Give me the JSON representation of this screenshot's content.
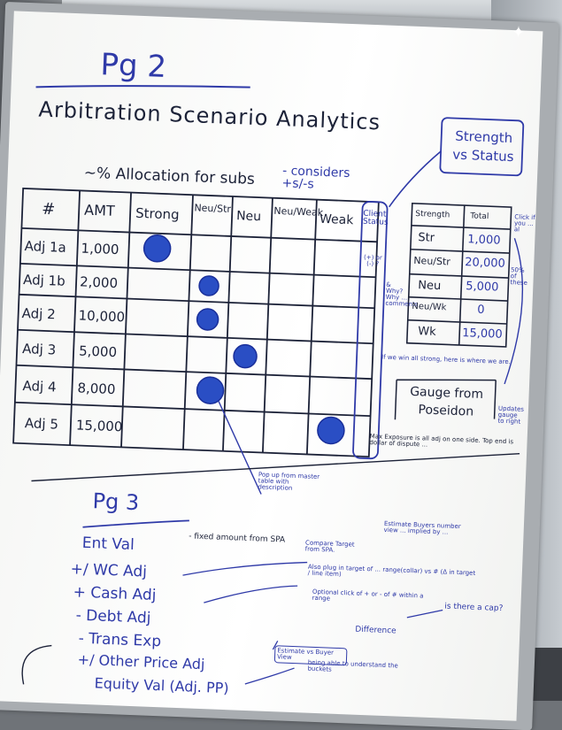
{
  "whiteboard": {
    "page2": {
      "heading": "Pg 2",
      "title": "Arbitration Scenario Analytics",
      "allocation_note": "~% Allocation for subs",
      "considers_note": "- considers +s/-s",
      "strength_box_label": "Strength vs Status",
      "columns": [
        "#",
        "AMT",
        "Strong",
        "Neu/Str",
        "Neu",
        "Neu/Weak",
        "Weak"
      ],
      "rows": [
        {
          "id": "Adj 1a",
          "amt": "1,000",
          "dot_column": "Strong"
        },
        {
          "id": "Adj 1b",
          "amt": "2,000",
          "dot_column": "Neu/Str"
        },
        {
          "id": "Adj 2",
          "amt": "10,000",
          "dot_column": "Neu/Str"
        },
        {
          "id": "Adj 3",
          "amt": "5,000",
          "dot_column": "Neu"
        },
        {
          "id": "Adj 4",
          "amt": "8,000",
          "dot_column": "Neu/Str"
        },
        {
          "id": "Adj 5",
          "amt": "15,000",
          "dot_column": "Weak"
        }
      ],
      "client_status_label": "Client Status",
      "side_column_note": "(+) or (-) ?",
      "why_note": "& Why? Why ... comments",
      "summary_table": {
        "headers": [
          "Strength",
          "Total"
        ],
        "rows": [
          {
            "strength": "Str",
            "total": "1,000"
          },
          {
            "strength": "Neu/Str",
            "total": "20,000"
          },
          {
            "strength": "Neu",
            "total": "5,000"
          },
          {
            "strength": "Neu/Wk",
            "total": "0"
          },
          {
            "strength": "Wk",
            "total": "15,000"
          }
        ]
      },
      "click_note": "Click if you ... al",
      "pct_note": "50% of these",
      "all_strong_note": "If we win all strong, here is where we are.",
      "gauge_label": "Gauge from Poseidon",
      "updates_note": "Updates gauge to right",
      "max_exposure_note": "Max Exposure is all adj on one side. Top end is dollar of dispute ...",
      "popup_note": "Pop up from master table with description"
    },
    "page3": {
      "heading": "Pg 3",
      "lines": [
        "Ent Val",
        "+/ WC Adj",
        "+ Cash Adj",
        "- Debt Adj",
        "- Trans Exp",
        "+/ Other Price Adj",
        "Equity Val (Adj. PP)"
      ],
      "fixed_note": "- fixed amount from SPA",
      "compare_note": "Compare Target from SPA.",
      "estimates_note": "Estimate Buyers number view ... implied by ...",
      "also_note": "Also plug in target of ... range(collar) vs # (Δ in target / line item)",
      "optional_note": "Optional click of + or - of # within a range",
      "estimate_box": "Estimate vs Buyer View",
      "difference_note": "Difference",
      "cap_note": "is there a cap?",
      "bottom_note": "being able to understand the buckets"
    },
    "colors": {
      "marker_blue": "#2f3aa8",
      "marker_black": "#1c2238",
      "dot_blue": "#2a4ec4"
    }
  }
}
